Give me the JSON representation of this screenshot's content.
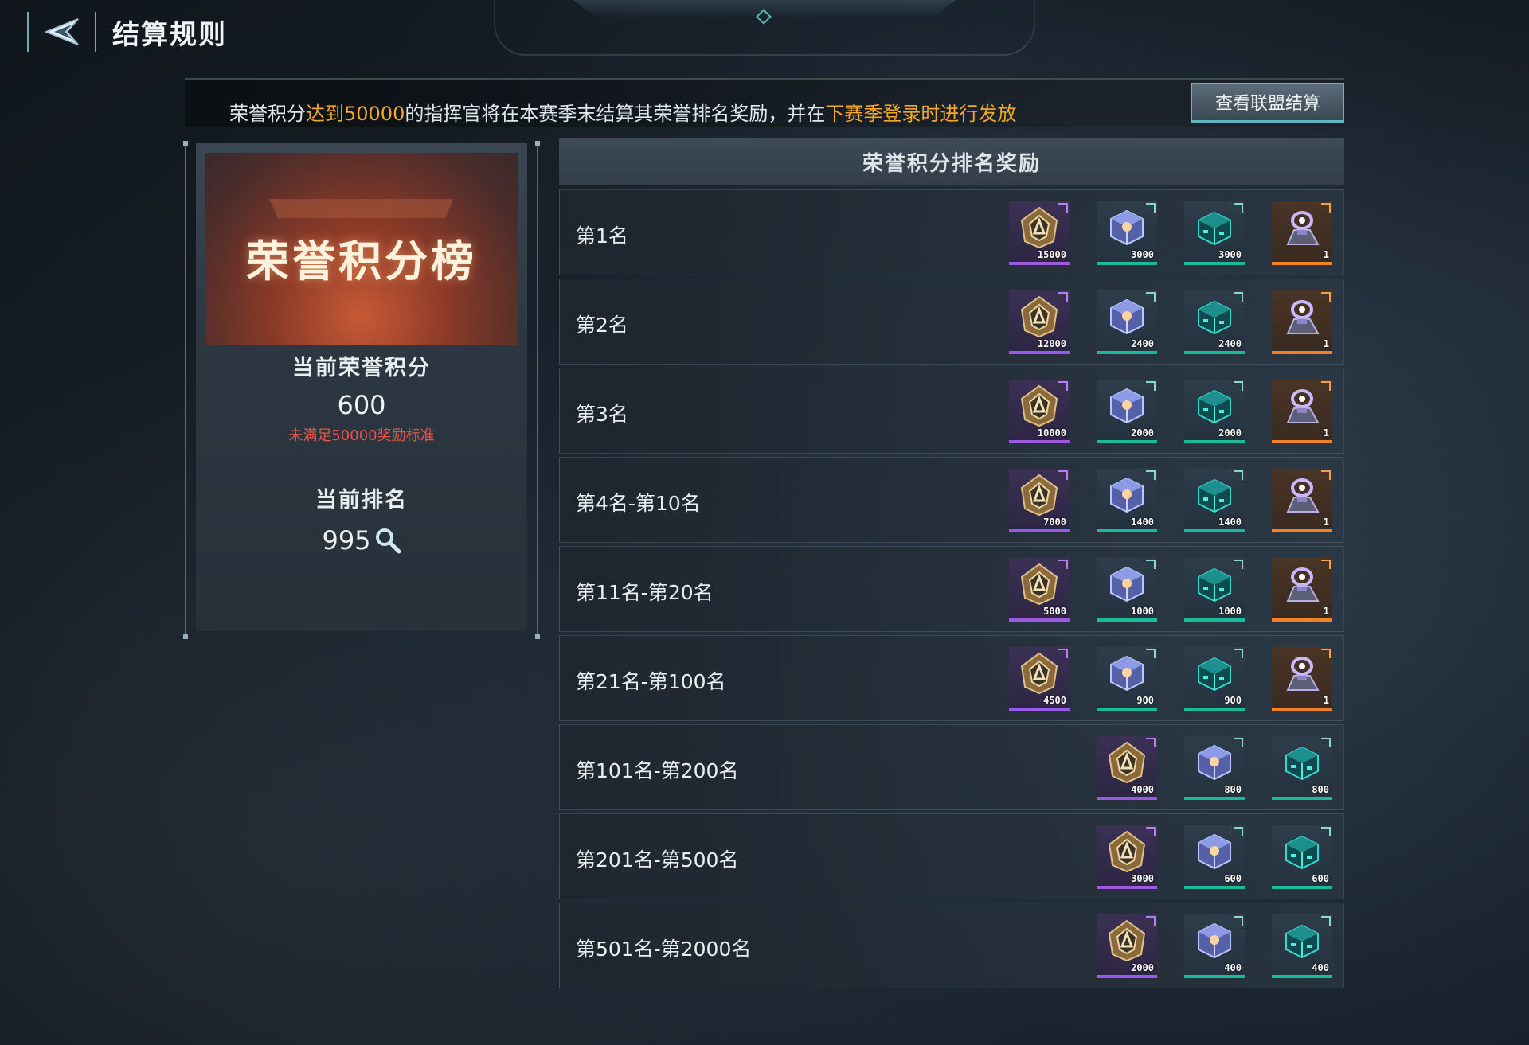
{
  "header": {
    "title": "结算规则"
  },
  "notice": {
    "part1": "荣誉积分",
    "part2": "达到50000",
    "part3": "的指挥官将在本赛季末结算其荣誉排名奖励，并在",
    "part4": "下赛季登录时进行发放"
  },
  "alliance_button": "查看联盟结算",
  "left_panel": {
    "banner_title": "荣誉积分榜",
    "score_label": "当前荣誉积分",
    "score_value": "600",
    "warning": "未满足50000奖励标准",
    "rank_label": "当前排名",
    "rank_value": "995"
  },
  "list_title": "荣誉积分排名奖励",
  "rows": [
    {
      "label": "第1名",
      "rewards": [
        {
          "icon": "honor-badge-icon",
          "qty": "15000",
          "rarity": "purple"
        },
        {
          "icon": "crystal-cube-icon",
          "qty": "3000",
          "rarity": "teal"
        },
        {
          "icon": "teal-cube-icon",
          "qty": "3000",
          "rarity": "teal"
        },
        {
          "icon": "hologram-device-icon",
          "qty": "1",
          "rarity": "orange"
        }
      ]
    },
    {
      "label": "第2名",
      "rewards": [
        {
          "icon": "honor-badge-icon",
          "qty": "12000",
          "rarity": "purple"
        },
        {
          "icon": "crystal-cube-icon",
          "qty": "2400",
          "rarity": "teal"
        },
        {
          "icon": "teal-cube-icon",
          "qty": "2400",
          "rarity": "teal"
        },
        {
          "icon": "hologram-device-icon",
          "qty": "1",
          "rarity": "orange"
        }
      ]
    },
    {
      "label": "第3名",
      "rewards": [
        {
          "icon": "honor-badge-icon",
          "qty": "10000",
          "rarity": "purple"
        },
        {
          "icon": "crystal-cube-icon",
          "qty": "2000",
          "rarity": "teal"
        },
        {
          "icon": "teal-cube-icon",
          "qty": "2000",
          "rarity": "teal"
        },
        {
          "icon": "hologram-device-icon",
          "qty": "1",
          "rarity": "orange"
        }
      ]
    },
    {
      "label": "第4名-第10名",
      "rewards": [
        {
          "icon": "honor-badge-icon",
          "qty": "7000",
          "rarity": "purple"
        },
        {
          "icon": "crystal-cube-icon",
          "qty": "1400",
          "rarity": "teal"
        },
        {
          "icon": "teal-cube-icon",
          "qty": "1400",
          "rarity": "teal"
        },
        {
          "icon": "hologram-device-icon",
          "qty": "1",
          "rarity": "orange"
        }
      ]
    },
    {
      "label": "第11名-第20名",
      "rewards": [
        {
          "icon": "honor-badge-icon",
          "qty": "5000",
          "rarity": "purple"
        },
        {
          "icon": "crystal-cube-icon",
          "qty": "1000",
          "rarity": "teal"
        },
        {
          "icon": "teal-cube-icon",
          "qty": "1000",
          "rarity": "teal"
        },
        {
          "icon": "hologram-device-icon",
          "qty": "1",
          "rarity": "orange"
        }
      ]
    },
    {
      "label": "第21名-第100名",
      "rewards": [
        {
          "icon": "honor-badge-icon",
          "qty": "4500",
          "rarity": "purple"
        },
        {
          "icon": "crystal-cube-icon",
          "qty": "900",
          "rarity": "teal"
        },
        {
          "icon": "teal-cube-icon",
          "qty": "900",
          "rarity": "teal"
        },
        {
          "icon": "hologram-device-icon",
          "qty": "1",
          "rarity": "orange"
        }
      ]
    },
    {
      "label": "第101名-第200名",
      "rewards": [
        {
          "icon": "honor-badge-icon",
          "qty": "4000",
          "rarity": "purple"
        },
        {
          "icon": "crystal-cube-icon",
          "qty": "800",
          "rarity": "teal"
        },
        {
          "icon": "teal-cube-icon",
          "qty": "800",
          "rarity": "teal"
        }
      ]
    },
    {
      "label": "第201名-第500名",
      "rewards": [
        {
          "icon": "honor-badge-icon",
          "qty": "3000",
          "rarity": "purple"
        },
        {
          "icon": "crystal-cube-icon",
          "qty": "600",
          "rarity": "teal"
        },
        {
          "icon": "teal-cube-icon",
          "qty": "600",
          "rarity": "teal"
        }
      ]
    },
    {
      "label": "第501名-第2000名",
      "rewards": [
        {
          "icon": "honor-badge-icon",
          "qty": "2000",
          "rarity": "purple"
        },
        {
          "icon": "crystal-cube-icon",
          "qty": "400",
          "rarity": "teal"
        },
        {
          "icon": "teal-cube-icon",
          "qty": "400",
          "rarity": "teal"
        }
      ]
    }
  ],
  "colors": {
    "highlight": "#f4a728",
    "warning": "#e0574a",
    "purple_rarity": "#9a5ae6",
    "teal_rarity": "#1abb9a",
    "orange_rarity": "#f0832a"
  }
}
